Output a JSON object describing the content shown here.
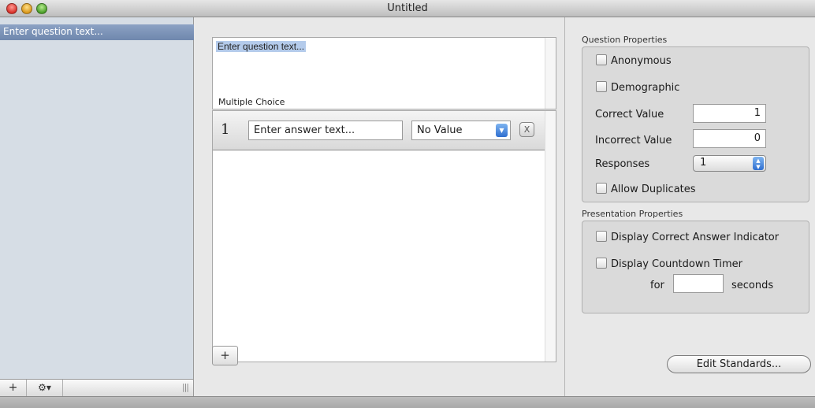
{
  "window": {
    "title": "Untitled"
  },
  "sidebar": {
    "items": [
      {
        "label": "Enter question text..."
      }
    ],
    "add_label": "+",
    "gear_label": "⚙▾",
    "grip_label": "|||"
  },
  "question": {
    "text": "Enter question text..."
  },
  "multiple_choice": {
    "label": "Multiple Choice",
    "answers": [
      {
        "number": "1",
        "placeholder": "Enter answer text...",
        "value": "No Value",
        "remove_label": "X"
      }
    ],
    "add_label": "+"
  },
  "question_properties": {
    "label": "Question Properties",
    "anonymous": "Anonymous",
    "demographic": "Demographic",
    "correct_value_label": "Correct Value",
    "correct_value": "1",
    "incorrect_value_label": "Incorrect Value",
    "incorrect_value": "0",
    "responses_label": "Responses",
    "responses_value": "1",
    "allow_duplicates": "Allow Duplicates"
  },
  "presentation_properties": {
    "label": "Presentation Properties",
    "display_correct": "Display Correct Answer Indicator",
    "display_timer": "Display Countdown Timer",
    "for_label": "for",
    "seconds_label": "seconds",
    "seconds_value": ""
  },
  "edit_standards_label": "Edit Standards...",
  "colors": {
    "accent": "#6f87ad",
    "selection": "#b4cbeb",
    "sidebar_bg": "#d6dde5"
  }
}
